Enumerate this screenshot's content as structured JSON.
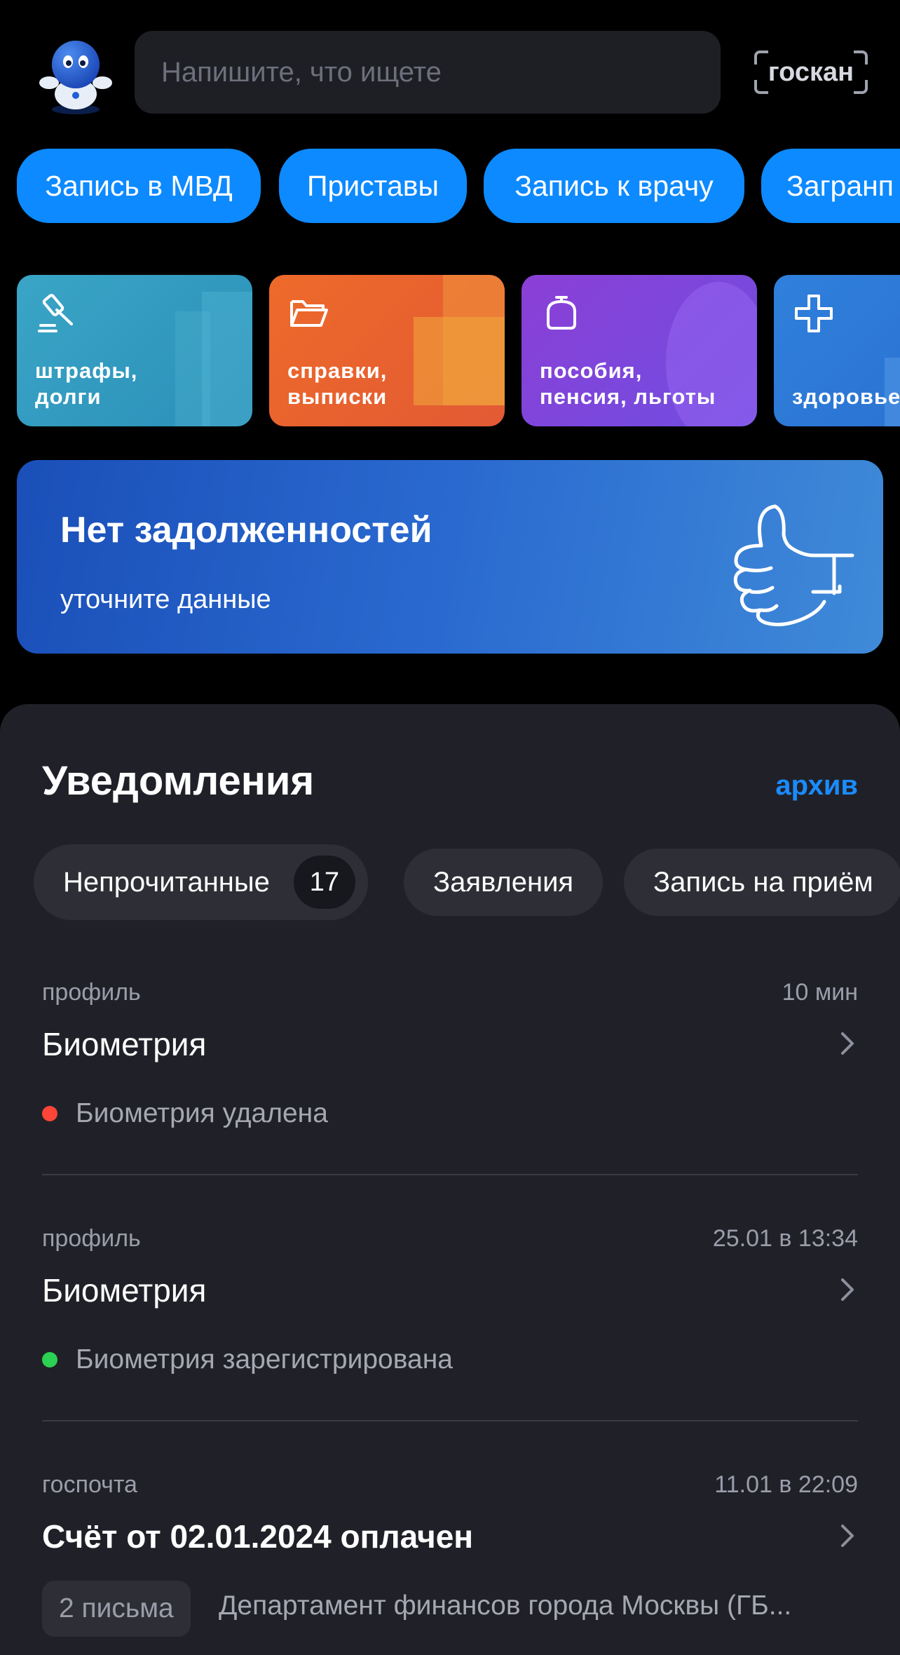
{
  "search": {
    "placeholder": "Напишите, что ищете"
  },
  "goskan": {
    "label": "госкан"
  },
  "quick_chips": [
    {
      "label": "Запись в МВД"
    },
    {
      "label": "Приставы"
    },
    {
      "label": "Запись к врачу"
    },
    {
      "label": "Загранп"
    }
  ],
  "tiles": [
    {
      "label": "штрафы,\nдолги",
      "icon": "gavel-icon",
      "color": "#2e9fc0"
    },
    {
      "label": "справки,\nвыписки",
      "icon": "folder-icon",
      "color": "#e76b2c"
    },
    {
      "label": "пособия,\nпенсия, льготы",
      "icon": "wallet-icon",
      "color": "#7b46d6"
    },
    {
      "label": "здоровье",
      "icon": "plus-icon",
      "color": "#2a78d8"
    }
  ],
  "debt_card": {
    "title": "Нет задолженностей",
    "subtitle": "уточните данные",
    "icon": "thumbs-up-icon"
  },
  "notifications_panel": {
    "heading": "Уведомления",
    "archive_label": "архив",
    "filters": [
      {
        "label": "Непрочитанные",
        "count": "17"
      },
      {
        "label": "Заявления"
      },
      {
        "label": "Запись на приём"
      }
    ],
    "items": [
      {
        "category": "профиль",
        "time": "10 мин",
        "title": "Биометрия",
        "status_text": "Биометрия удалена",
        "status_color": "#ff4438"
      },
      {
        "category": "профиль",
        "time": "25.01 в 13:34",
        "title": "Биометрия",
        "status_text": "Биометрия зарегистрирована",
        "status_color": "#2bd152"
      },
      {
        "category": "госпочта",
        "time": "11.01 в 22:09",
        "title": "Счёт от 02.01.2024 оплачен",
        "letters_count": "2 письма",
        "sender": "Департамент финансов города Москвы (ГБ..."
      }
    ]
  },
  "colors": {
    "background": "#000000",
    "accent": "#0d8aff",
    "panel": "#202128",
    "link": "#1a8cff"
  }
}
